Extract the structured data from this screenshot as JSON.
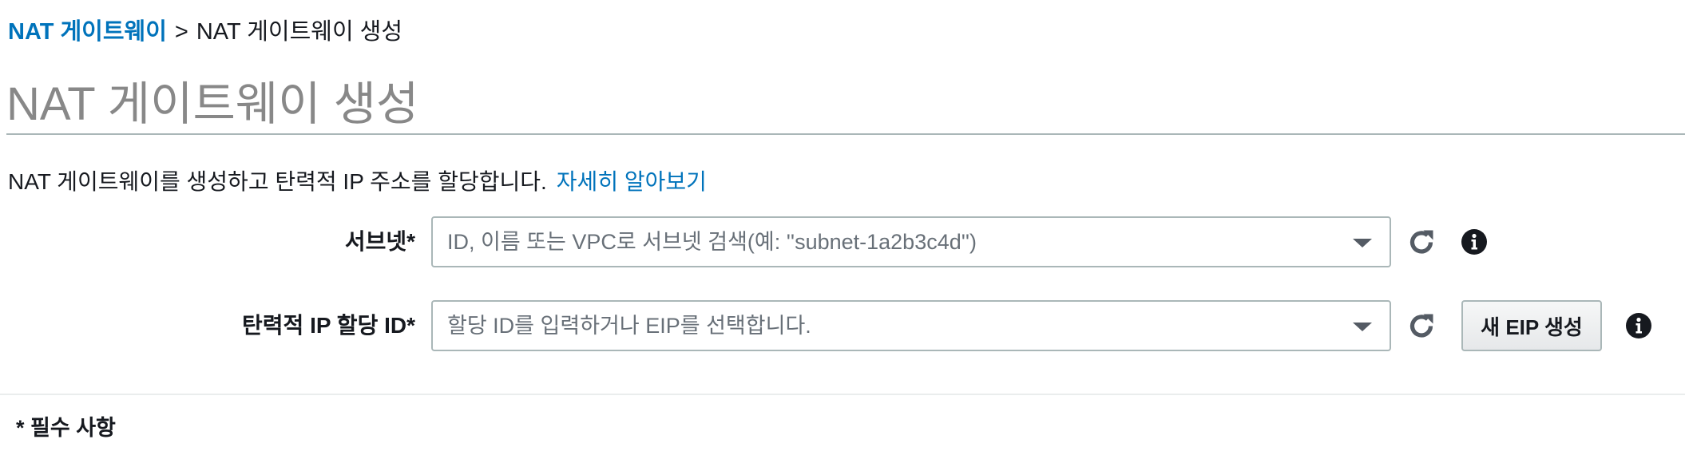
{
  "breadcrumb": {
    "parent": "NAT 게이트웨이",
    "separator": ">",
    "current": "NAT 게이트웨이 생성"
  },
  "page": {
    "title": "NAT 게이트웨이 생성",
    "description": "NAT 게이트웨이를 생성하고 탄력적 IP 주소를 할당합니다.",
    "learn_more": "자세히 알아보기"
  },
  "form": {
    "subnet": {
      "label": "서브넷*",
      "placeholder": "ID, 이름 또는 VPC로 서브넷 검색(예: ''subnet-1a2b3c4d'')"
    },
    "eip": {
      "label": "탄력적 IP 할당 ID*",
      "placeholder": "할당 ID를 입력하거나 EIP를 선택합니다.",
      "new_eip_button": "새 EIP 생성"
    },
    "required_note": "* 필수 사항"
  },
  "colors": {
    "link": "#0073bb",
    "title": "#888888",
    "border": "#aab7b8",
    "icon": "#545b64"
  },
  "icons": {
    "refresh": "refresh-icon",
    "info": "info-icon",
    "dropdown": "caret-down-icon"
  }
}
